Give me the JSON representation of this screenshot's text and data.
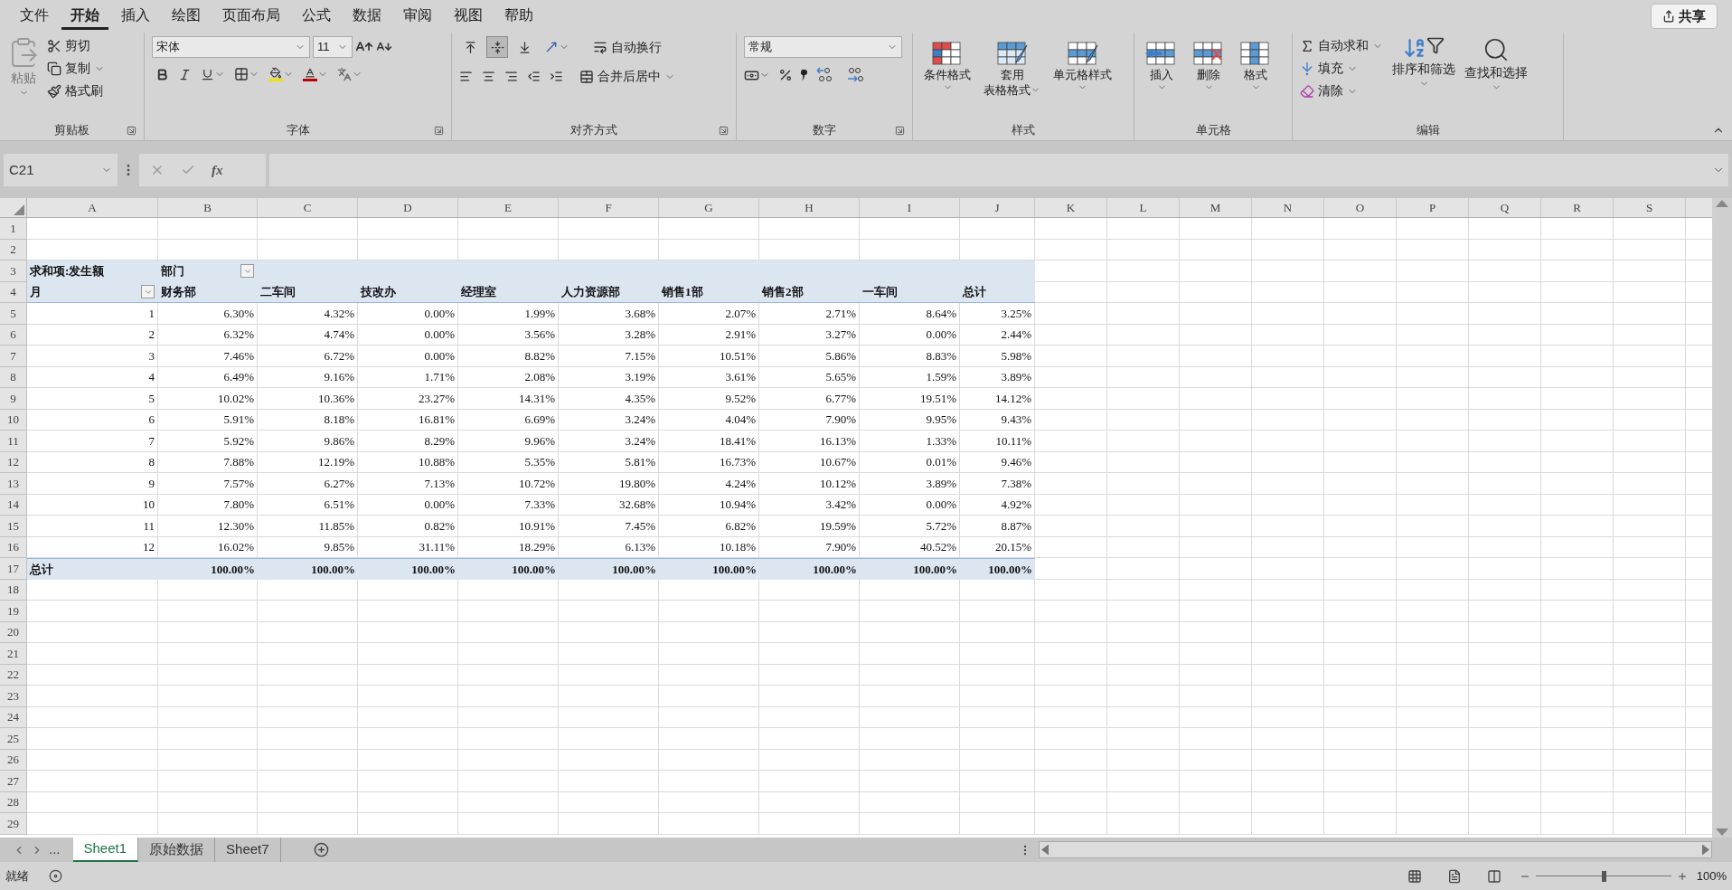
{
  "menu_tabs": [
    {
      "label": "文件",
      "selected": false
    },
    {
      "label": "开始",
      "selected": true
    },
    {
      "label": "插入",
      "selected": false
    },
    {
      "label": "绘图",
      "selected": false
    },
    {
      "label": "页面布局",
      "selected": false
    },
    {
      "label": "公式",
      "selected": false
    },
    {
      "label": "数据",
      "selected": false
    },
    {
      "label": "审阅",
      "selected": false
    },
    {
      "label": "视图",
      "selected": false
    },
    {
      "label": "帮助",
      "selected": false
    }
  ],
  "share_button": "共享",
  "ribbon": {
    "clipboard": {
      "label": "剪贴板",
      "paste": "粘贴",
      "cut": "剪切",
      "copy": "复制",
      "format_painter": "格式刷"
    },
    "font": {
      "label": "字体",
      "font_name": "宋体",
      "font_size": "11"
    },
    "alignment": {
      "label": "对齐方式",
      "vertical": [
        {
          "selected": false
        },
        {
          "selected": true
        },
        {
          "selected": false
        }
      ],
      "wrap_text": "自动换行",
      "merge": "合并后居中"
    },
    "number": {
      "label": "数字",
      "format": "常规"
    },
    "styles": {
      "label": "样式",
      "conditional": "条件格式",
      "table_format_1": "套用",
      "table_format_2": "表格格式",
      "cell_styles": "单元格样式"
    },
    "cells": {
      "label": "单元格",
      "insert": "插入",
      "delete": "删除",
      "format": "格式"
    },
    "editing": {
      "label": "编辑",
      "autosum": "自动求和",
      "fill": "填充",
      "clear": "清除",
      "sort_filter": "排序和筛选",
      "find_select": "查找和选择"
    }
  },
  "formula_bar": {
    "name_box": "C21",
    "function_label": "fx"
  },
  "sheet": {
    "columns": [
      "A",
      "B",
      "C",
      "D",
      "E",
      "F",
      "G",
      "H",
      "I",
      "J",
      "K",
      "L",
      "M",
      "N",
      "O",
      "P",
      "Q",
      "R",
      "S"
    ],
    "row_numbers": [
      "1",
      "2",
      "3",
      "4",
      "5",
      "6",
      "7",
      "8",
      "9",
      "10",
      "11",
      "12",
      "13",
      "14",
      "15",
      "16",
      "17",
      "18",
      "19",
      "20",
      "21",
      "22",
      "23",
      "24",
      "25",
      "26",
      "27",
      "28",
      "29"
    ]
  },
  "pivot": {
    "value_field": "求和项:发生额",
    "column_field": "部门",
    "row_field": "月",
    "headers": [
      "财务部",
      "二车间",
      "技改办",
      "经理室",
      "人力资源部",
      "销售1部",
      "销售2部",
      "一车间",
      "总计"
    ],
    "rows": [
      {
        "label": "1",
        "values": [
          "6.30%",
          "4.32%",
          "0.00%",
          "1.99%",
          "3.68%",
          "2.07%",
          "2.71%",
          "8.64%",
          "3.25%"
        ]
      },
      {
        "label": "2",
        "values": [
          "6.32%",
          "4.74%",
          "0.00%",
          "3.56%",
          "3.28%",
          "2.91%",
          "3.27%",
          "0.00%",
          "2.44%"
        ]
      },
      {
        "label": "3",
        "values": [
          "7.46%",
          "6.72%",
          "0.00%",
          "8.82%",
          "7.15%",
          "10.51%",
          "5.86%",
          "8.83%",
          "5.98%"
        ]
      },
      {
        "label": "4",
        "values": [
          "6.49%",
          "9.16%",
          "1.71%",
          "2.08%",
          "3.19%",
          "3.61%",
          "5.65%",
          "1.59%",
          "3.89%"
        ]
      },
      {
        "label": "5",
        "values": [
          "10.02%",
          "10.36%",
          "23.27%",
          "14.31%",
          "4.35%",
          "9.52%",
          "6.77%",
          "19.51%",
          "14.12%"
        ]
      },
      {
        "label": "6",
        "values": [
          "5.91%",
          "8.18%",
          "16.81%",
          "6.69%",
          "3.24%",
          "4.04%",
          "7.90%",
          "9.95%",
          "9.43%"
        ]
      },
      {
        "label": "7",
        "values": [
          "5.92%",
          "9.86%",
          "8.29%",
          "9.96%",
          "3.24%",
          "18.41%",
          "16.13%",
          "1.33%",
          "10.11%"
        ]
      },
      {
        "label": "8",
        "values": [
          "7.88%",
          "12.19%",
          "10.88%",
          "5.35%",
          "5.81%",
          "16.73%",
          "10.67%",
          "0.01%",
          "9.46%"
        ]
      },
      {
        "label": "9",
        "values": [
          "7.57%",
          "6.27%",
          "7.13%",
          "10.72%",
          "19.80%",
          "4.24%",
          "10.12%",
          "3.89%",
          "7.38%"
        ]
      },
      {
        "label": "10",
        "values": [
          "7.80%",
          "6.51%",
          "0.00%",
          "7.33%",
          "32.68%",
          "10.94%",
          "3.42%",
          "0.00%",
          "4.92%"
        ]
      },
      {
        "label": "11",
        "values": [
          "12.30%",
          "11.85%",
          "0.82%",
          "10.91%",
          "7.45%",
          "6.82%",
          "19.59%",
          "5.72%",
          "8.87%"
        ]
      },
      {
        "label": "12",
        "values": [
          "16.02%",
          "9.85%",
          "31.11%",
          "18.29%",
          "6.13%",
          "10.18%",
          "7.90%",
          "40.52%",
          "20.15%"
        ]
      }
    ],
    "total": {
      "label": "总计",
      "values": [
        "100.00%",
        "100.00%",
        "100.00%",
        "100.00%",
        "100.00%",
        "100.00%",
        "100.00%",
        "100.00%",
        "100.00%"
      ]
    }
  },
  "sheet_tabs": {
    "overflow": "...",
    "tabs": [
      {
        "label": "Sheet1",
        "selected": true
      },
      {
        "label": "原始数据",
        "selected": false
      },
      {
        "label": "Sheet7",
        "selected": false
      }
    ]
  },
  "status_bar": {
    "status": "就绪",
    "zoom_slider": {
      "level": 0.5
    },
    "zoom": "100%"
  }
}
